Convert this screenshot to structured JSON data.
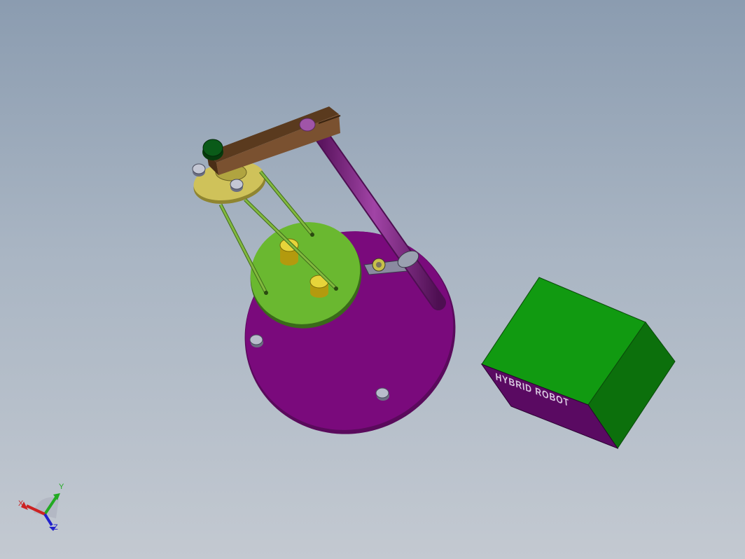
{
  "viewport": {
    "background_top": "#8b9cb0",
    "background_bottom": "#c3c9d1"
  },
  "model": {
    "colors": {
      "base_plate": "#7a0a7c",
      "column": "#7a1e80",
      "arm": "#7a5130",
      "small_plate": "#cfc25a",
      "moving_platform": "#6ab830",
      "rods": "#6a9a32",
      "yellow_pins": "#d9c21e",
      "box": "#119a11",
      "box_bottom": "#5a0a62",
      "knob": "#0a4a12"
    },
    "box_face_text": "HYBRID ROBOT"
  },
  "triad": {
    "x_label": "X",
    "y_label": "Y",
    "z_label": "Z"
  }
}
